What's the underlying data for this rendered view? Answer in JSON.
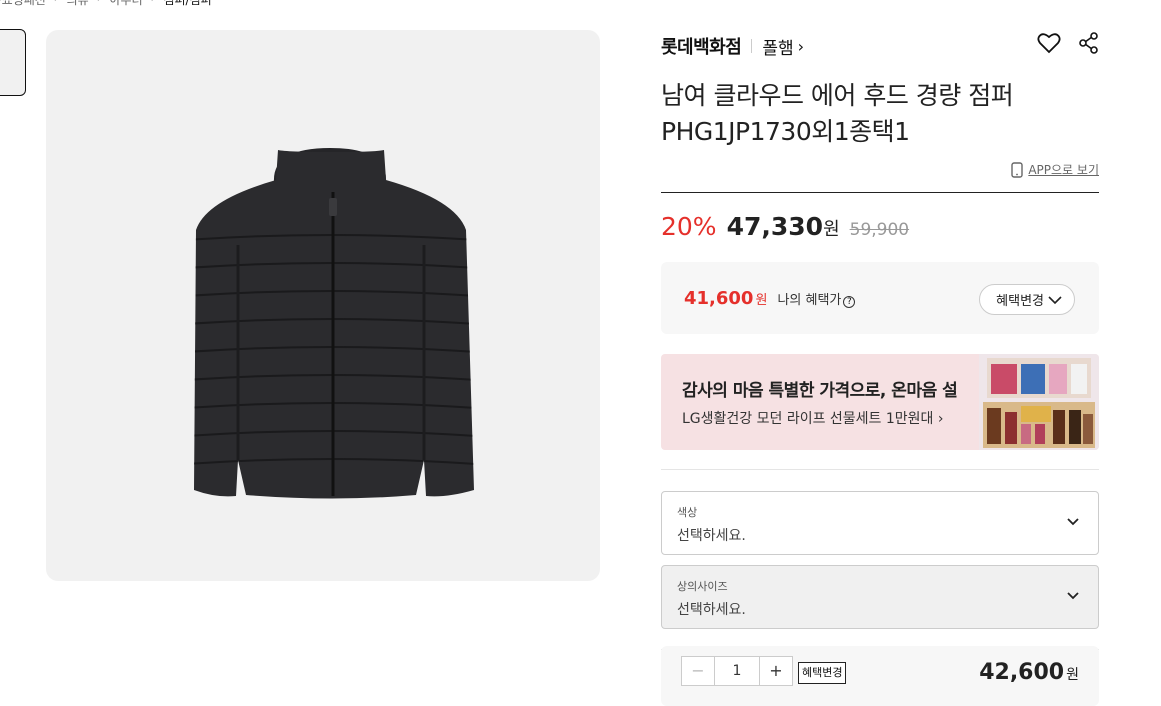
{
  "breadcrumb": {
    "items": [
      "··쇼핑패션",
      "의류",
      "아우터",
      "점퍼/점퍼"
    ]
  },
  "product": {
    "brand": "롯데백화점",
    "store": "폴햄",
    "title": "남여 클라우드 에어 후드 경량 점퍼 PHG1JP1730외1종택1",
    "app_link": "APP으로 보기"
  },
  "price": {
    "discount": "20%",
    "sale": "47,330",
    "won": "원",
    "original": "59,900"
  },
  "benefit": {
    "price": "41,600",
    "won": "원",
    "label": "나의 혜택가",
    "help": "?",
    "button": "혜택변경"
  },
  "banner": {
    "title": "감사의 마음 특별한 가격으로, 온마음 설",
    "subtitle": "LG생활건강 모던 라이프 선물세트 1만원대"
  },
  "options": [
    {
      "label": "색상",
      "value": "선택하세요."
    },
    {
      "label": "상의사이즈",
      "value": "선택하세요."
    }
  ],
  "order": {
    "minus": "−",
    "quantity": "1",
    "plus": "+",
    "change": "혜택변경",
    "price": "42,600",
    "won": "원"
  },
  "colors": {
    "accent_red": "#e5302b",
    "image_bg": "#f1f1f1",
    "jacket": "#2b2b2e",
    "banner_bg": "#f6e1e3"
  }
}
